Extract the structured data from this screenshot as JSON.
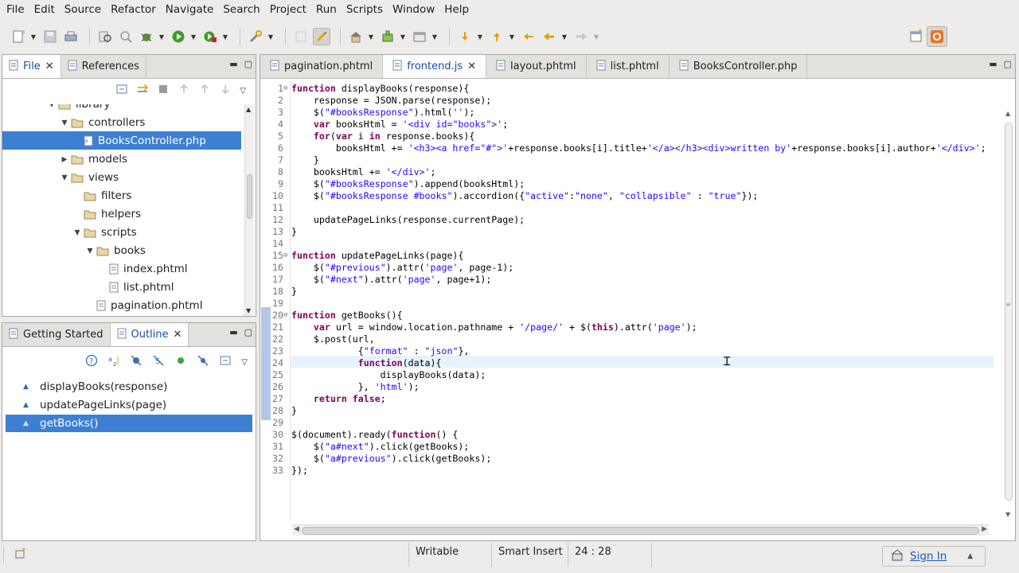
{
  "menubar": {
    "items": [
      "File",
      "Edit",
      "Source",
      "Refactor",
      "Navigate",
      "Search",
      "Project",
      "Run",
      "Scripts",
      "Window",
      "Help"
    ]
  },
  "left_top_panel": {
    "tabs": [
      {
        "label": "File",
        "closable": true,
        "active": true
      },
      {
        "label": "References",
        "closable": false,
        "active": false
      }
    ]
  },
  "tree": {
    "items": [
      {
        "label": "library",
        "depth": 5,
        "arrow": "open",
        "icon": "folder-icon"
      },
      {
        "label": "controllers",
        "depth": 6,
        "arrow": "open",
        "icon": "folder-icon"
      },
      {
        "label": "BooksController.php",
        "depth": 7,
        "arrow": "",
        "icon": "php-file-icon",
        "selected": true
      },
      {
        "label": "models",
        "depth": 6,
        "arrow": "closed",
        "icon": "folder-icon"
      },
      {
        "label": "views",
        "depth": 6,
        "arrow": "open",
        "icon": "folder-icon"
      },
      {
        "label": "filters",
        "depth": 7,
        "arrow": "",
        "icon": "folder-icon"
      },
      {
        "label": "helpers",
        "depth": 7,
        "arrow": "",
        "icon": "folder-icon"
      },
      {
        "label": "scripts",
        "depth": 7,
        "arrow": "open",
        "icon": "folder-icon"
      },
      {
        "label": "books",
        "depth": 8,
        "arrow": "open",
        "icon": "folder-icon"
      },
      {
        "label": "index.phtml",
        "depth": 9,
        "arrow": "",
        "icon": "file-icon"
      },
      {
        "label": "list.phtml",
        "depth": 9,
        "arrow": "",
        "icon": "file-icon"
      },
      {
        "label": "pagination.phtml",
        "depth": 8,
        "arrow": "",
        "icon": "file-icon"
      }
    ]
  },
  "outline_panel": {
    "tabs": [
      {
        "label": "Getting Started",
        "closable": false,
        "active": false
      },
      {
        "label": "Outline",
        "closable": true,
        "active": true
      }
    ],
    "items": [
      {
        "label": "displayBooks(response)",
        "selected": false
      },
      {
        "label": "updatePageLinks(page)",
        "selected": false
      },
      {
        "label": "getBooks()",
        "selected": true
      }
    ]
  },
  "editor": {
    "tabs": [
      {
        "label": "pagination.phtml",
        "active": false,
        "closable": false
      },
      {
        "label": "frontend.js",
        "active": true,
        "closable": true
      },
      {
        "label": "layout.phtml",
        "active": false,
        "closable": false
      },
      {
        "label": "list.phtml",
        "active": false,
        "closable": false
      },
      {
        "label": "BooksController.php",
        "active": false,
        "closable": false
      }
    ],
    "folds": [
      1,
      15,
      20
    ],
    "lines": [
      [
        [
          "kw",
          "function"
        ],
        [
          "",
          " displayBooks(response){"
        ]
      ],
      [
        [
          "",
          "    response = JSON.parse(response);"
        ]
      ],
      [
        [
          "",
          "    $("
        ],
        [
          "str",
          "\"#booksResponse\""
        ],
        [
          "",
          ").html("
        ],
        [
          "str",
          "''"
        ],
        [
          "",
          ");"
        ]
      ],
      [
        [
          "",
          "    "
        ],
        [
          "kw",
          "var"
        ],
        [
          "",
          " booksHtml = "
        ],
        [
          "str",
          "'<div id=\"books\">'"
        ],
        [
          "",
          ";"
        ]
      ],
      [
        [
          "",
          "    "
        ],
        [
          "kw",
          "for"
        ],
        [
          "",
          "("
        ],
        [
          "kw",
          "var"
        ],
        [
          "",
          " i "
        ],
        [
          "kw",
          "in"
        ],
        [
          "",
          " response.books){"
        ]
      ],
      [
        [
          "",
          "        booksHtml += "
        ],
        [
          "str",
          "'<h3><a href=\"#\">'"
        ],
        [
          "",
          "+response.books[i].title+"
        ],
        [
          "str",
          "'</a></h3><div>written by'"
        ],
        [
          "",
          "+response.books[i].author+"
        ],
        [
          "str",
          "'</div>'"
        ],
        [
          "",
          ";"
        ]
      ],
      [
        [
          "",
          "    }"
        ]
      ],
      [
        [
          "",
          "    booksHtml += "
        ],
        [
          "str",
          "'</div>'"
        ],
        [
          "",
          ";"
        ]
      ],
      [
        [
          "",
          "    $("
        ],
        [
          "str",
          "\"#booksResponse\""
        ],
        [
          "",
          ").append(booksHtml);"
        ]
      ],
      [
        [
          "",
          "    $("
        ],
        [
          "str",
          "\"#booksResponse #books\""
        ],
        [
          "",
          ").accordion({"
        ],
        [
          "str",
          "\"active\""
        ],
        [
          "",
          ":"
        ],
        [
          "str",
          "\"none\""
        ],
        [
          "",
          ", "
        ],
        [
          "str",
          "\"collapsible\""
        ],
        [
          "",
          " : "
        ],
        [
          "str",
          "\"true\""
        ],
        [
          "",
          "});"
        ]
      ],
      [
        [
          "",
          ""
        ]
      ],
      [
        [
          "",
          "    updatePageLinks(response.currentPage);"
        ]
      ],
      [
        [
          "",
          "}"
        ]
      ],
      [
        [
          "",
          ""
        ]
      ],
      [
        [
          "kw",
          "function"
        ],
        [
          "",
          " updatePageLinks(page){"
        ]
      ],
      [
        [
          "",
          "    $("
        ],
        [
          "str",
          "\"#previous\""
        ],
        [
          "",
          ").attr("
        ],
        [
          "str",
          "'page'"
        ],
        [
          "",
          ", page-1);"
        ]
      ],
      [
        [
          "",
          "    $("
        ],
        [
          "str",
          "\"#next\""
        ],
        [
          "",
          ").attr("
        ],
        [
          "str",
          "'page'"
        ],
        [
          "",
          ", page+1);"
        ]
      ],
      [
        [
          "",
          "}"
        ]
      ],
      [
        [
          "",
          ""
        ]
      ],
      [
        [
          "kw",
          "function"
        ],
        [
          "",
          " getBooks(){"
        ]
      ],
      [
        [
          "",
          "    "
        ],
        [
          "kw",
          "var"
        ],
        [
          "",
          " url = window.location.pathname + "
        ],
        [
          "str",
          "'/page/'"
        ],
        [
          "",
          " + $("
        ],
        [
          "kw",
          "this"
        ],
        [
          "",
          ").attr("
        ],
        [
          "str",
          "'page'"
        ],
        [
          "",
          ");"
        ]
      ],
      [
        [
          "",
          "    $.post(url,"
        ]
      ],
      [
        [
          "",
          "            {"
        ],
        [
          "str",
          "\"format\""
        ],
        [
          "",
          " : "
        ],
        [
          "str",
          "\"json\""
        ],
        [
          "",
          "},"
        ]
      ],
      [
        [
          "",
          "            "
        ],
        [
          "kw",
          "function"
        ],
        [
          "",
          "(data){"
        ]
      ],
      [
        [
          "",
          "                displayBooks(data);"
        ]
      ],
      [
        [
          "",
          "            }, "
        ],
        [
          "str",
          "'html'"
        ],
        [
          "",
          ");"
        ]
      ],
      [
        [
          "",
          "    "
        ],
        [
          "kw",
          "return"
        ],
        [
          "",
          " "
        ],
        [
          "kw",
          "false"
        ],
        [
          "",
          ";"
        ]
      ],
      [
        [
          "",
          "}"
        ]
      ],
      [
        [
          "",
          ""
        ]
      ],
      [
        [
          "",
          "$(document).ready("
        ],
        [
          "kw",
          "function"
        ],
        [
          "",
          "() {"
        ]
      ],
      [
        [
          "",
          "    $("
        ],
        [
          "str",
          "\"a#next\""
        ],
        [
          "",
          ").click(getBooks);"
        ]
      ],
      [
        [
          "",
          "    $("
        ],
        [
          "str",
          "\"a#previous\""
        ],
        [
          "",
          ").click(getBooks);"
        ]
      ],
      [
        [
          "",
          "});"
        ]
      ]
    ]
  },
  "statusbar": {
    "writable": "Writable",
    "insert_mode": "Smart Insert",
    "cursor_position": "24 : 28",
    "sign_in": "Sign In"
  },
  "colors": {
    "selection": "#3d7fd3",
    "keyword": "#7f0055",
    "string": "#2a00ff",
    "current_line": "#e8f2fe"
  }
}
